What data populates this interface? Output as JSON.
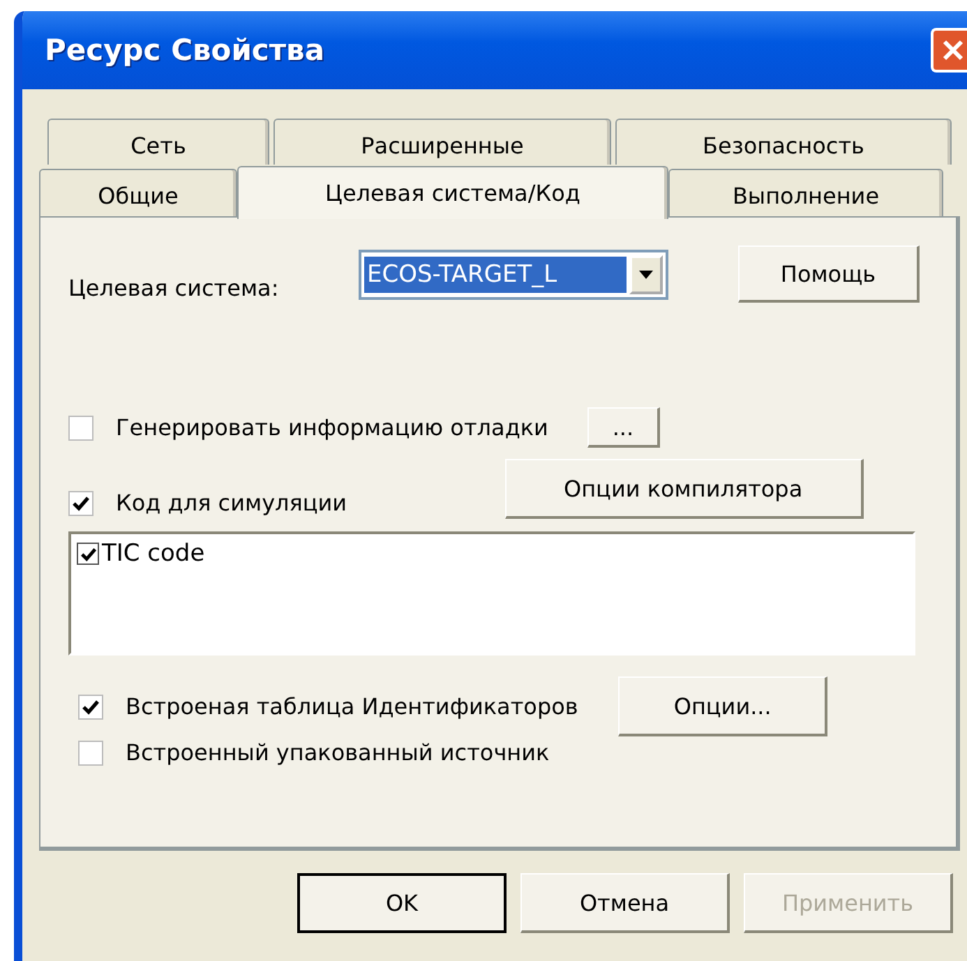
{
  "window": {
    "title": "Ресурс Свойства"
  },
  "tab_rows": [
    {
      "tabs": [
        {
          "label": "Сеть",
          "selected": false
        },
        {
          "label": "Расширенные",
          "selected": false
        },
        {
          "label": "Безопасность",
          "selected": false
        }
      ]
    },
    {
      "tabs": [
        {
          "label": "Общие",
          "selected": false
        },
        {
          "label": "Целевая система/Код",
          "selected": true
        },
        {
          "label": "Выполнение",
          "selected": false
        }
      ]
    }
  ],
  "target_system": {
    "label": "Целевая система:",
    "value": "ECOS-TARGET_L"
  },
  "help_button": "Помощь",
  "debug_info": {
    "label": "Генерировать информацию отладки",
    "checked": false
  },
  "ellipsis_button": "...",
  "simulation_code": {
    "label": "Код для симуляции",
    "checked": true
  },
  "compiler_options_button": "Опции компилятора",
  "code_list": [
    {
      "label": "TIC code",
      "checked": true
    }
  ],
  "id_table": {
    "label": "Встроеная таблица Идентификаторов",
    "checked": true
  },
  "options_button": "Опции...",
  "packed_source": {
    "label": "Встроенный упакованный источник",
    "checked": false
  },
  "buttons": [
    {
      "label": "OK",
      "default": true,
      "disabled": false
    },
    {
      "label": "Отмена",
      "default": false,
      "disabled": false
    },
    {
      "label": "Применить",
      "default": false,
      "disabled": true
    }
  ]
}
